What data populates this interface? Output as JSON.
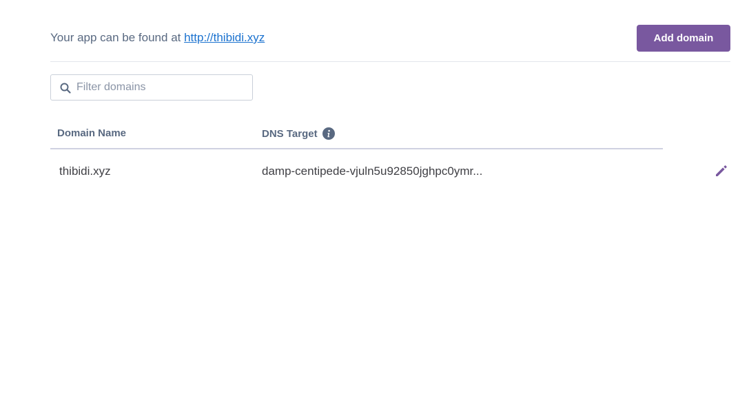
{
  "header": {
    "app_prefix": "Your app can be found at ",
    "app_url": "http://thibidi.xyz",
    "add_domain_label": "Add domain"
  },
  "filter": {
    "placeholder": "Filter domains",
    "value": ""
  },
  "table": {
    "columns": {
      "domain_name": "Domain Name",
      "dns_target": "DNS Target"
    },
    "rows": [
      {
        "domain": "thibidi.xyz",
        "dns_target": "damp-centipede-vjuln5u92850jghpc0ymr..."
      }
    ]
  },
  "icons": {
    "search": "search-icon",
    "info": "info-icon",
    "edit": "pencil-icon"
  },
  "colors": {
    "accent": "#79589f",
    "link": "#1b72cf",
    "text_muted": "#596981",
    "text_body": "#3f3f44"
  }
}
